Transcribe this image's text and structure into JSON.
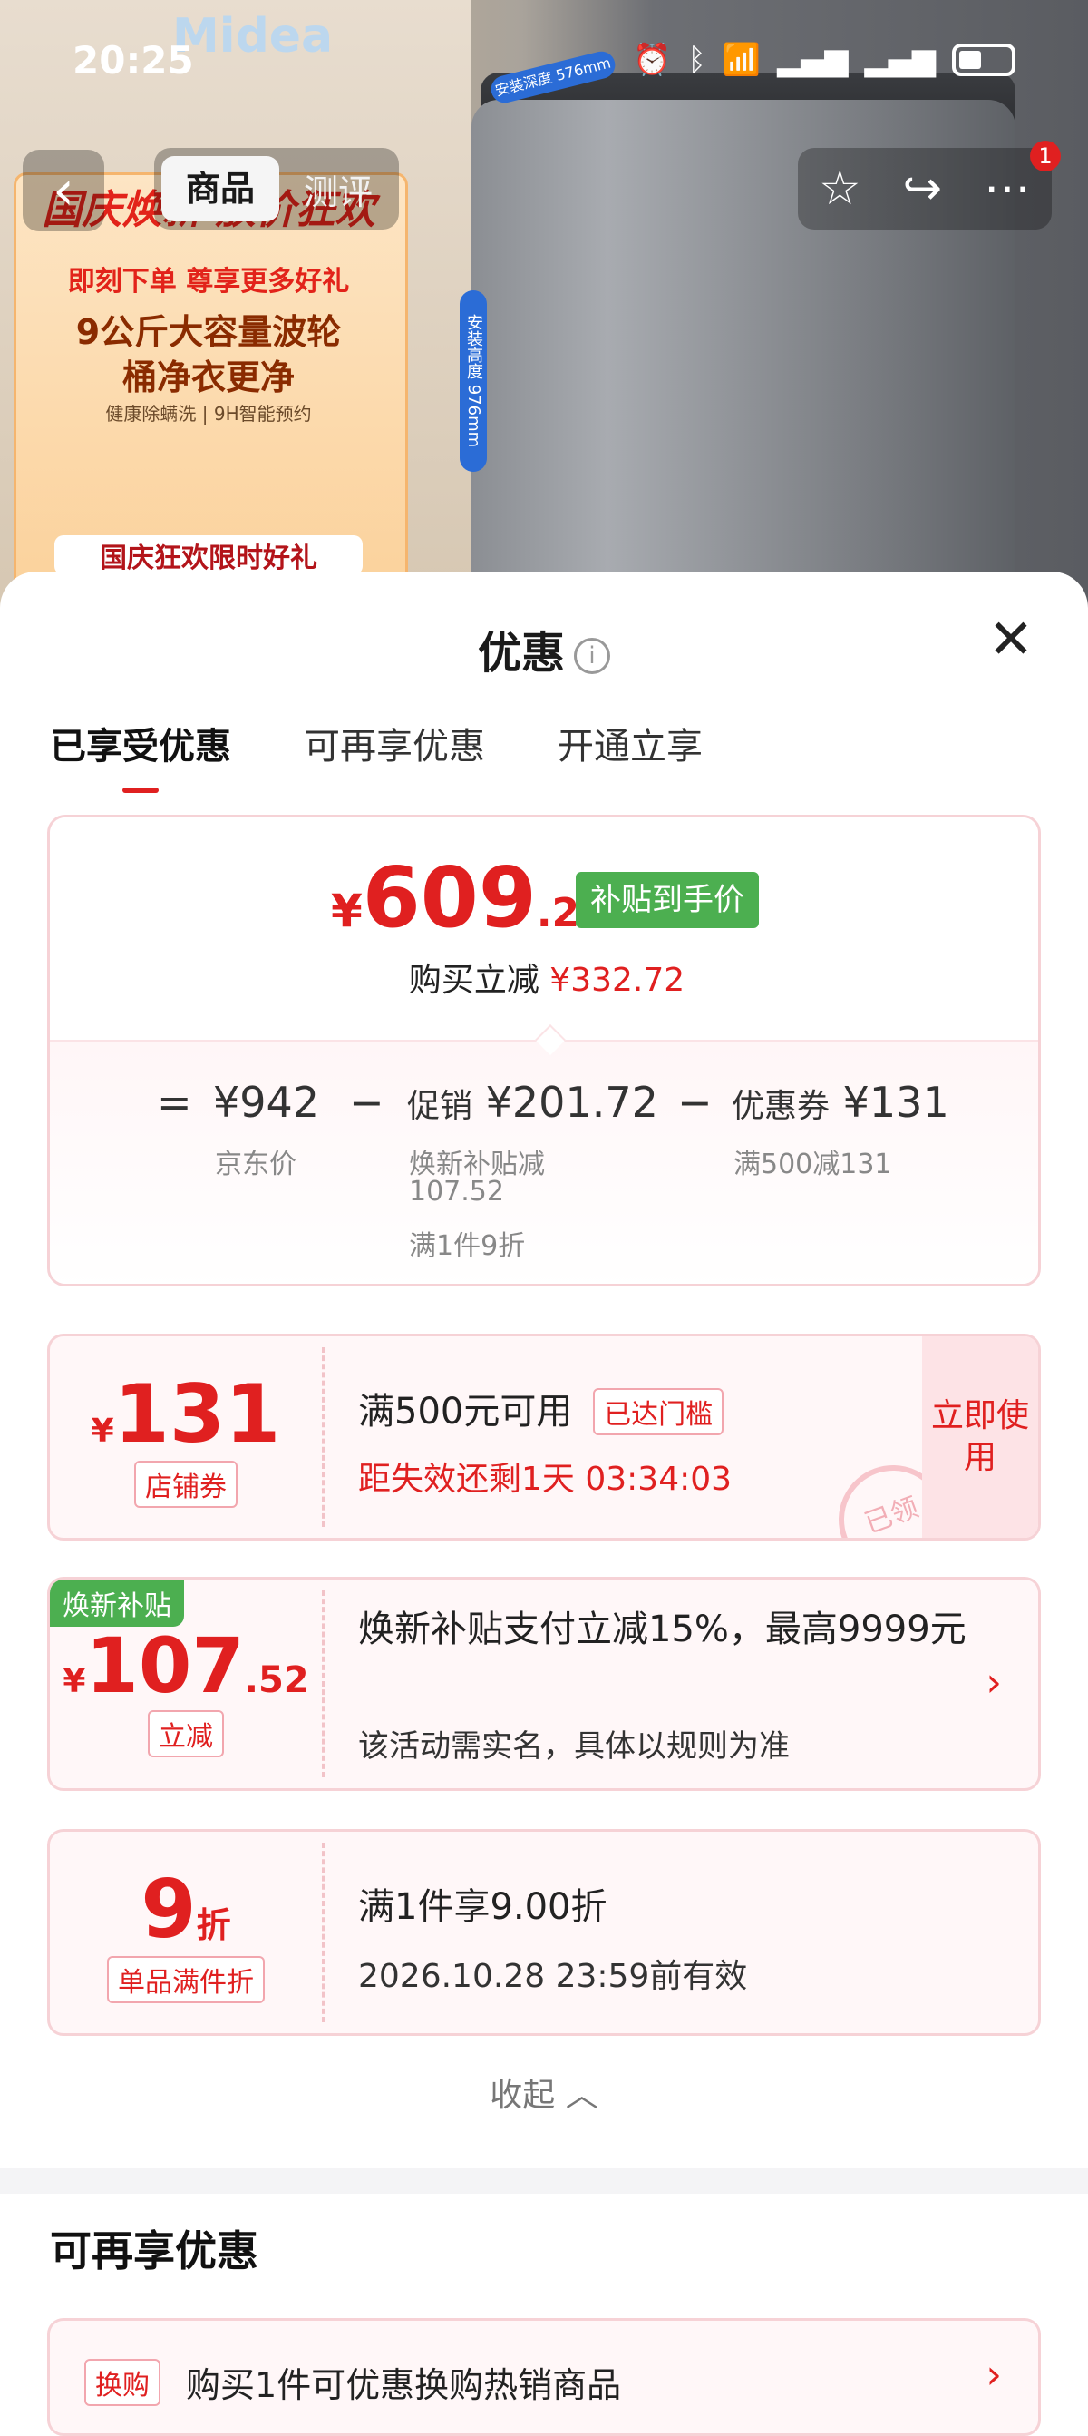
{
  "status_bar": {
    "time": "20:25"
  },
  "hero": {
    "brand": "Midea",
    "poster_headline": "国庆焕新 放价狂欢",
    "poster_sub": "即刻下单 尊享更多好礼",
    "poster_feature_1": "9公斤大容量波轮",
    "poster_feature_2": "桶净衣更净",
    "poster_feature_note": "健康除螨洗 | 9H智能预约",
    "poster_bottom": "国庆狂欢限时好礼",
    "dim_height": "安装高度 976mm",
    "dim_depth": "安装深度 576mm"
  },
  "nav": {
    "tab_product": "商品",
    "tab_review": "测评",
    "notification_count": "1"
  },
  "sheet": {
    "title": "优惠",
    "tabs": [
      "已享受优惠",
      "可再享优惠",
      "开通立享"
    ]
  },
  "summary": {
    "price_yen": "¥",
    "price_int": "609",
    "price_dec": ".28",
    "subsidy_tag": "补贴到手价",
    "reduce_label": "购买立减",
    "reduce_amount": "¥332.72",
    "eq_sign": "=",
    "jd_price": "¥942",
    "jd_price_label": "京东价",
    "minus": "−",
    "promo_label": "促销",
    "promo_amount": "¥201.72",
    "promo_detail_1": "焕新补贴减",
    "promo_detail_2": "107.52",
    "promo_detail_3": "满1件9折",
    "coupon_label": "优惠券",
    "coupon_amount": "¥131",
    "coupon_detail": "满500减131"
  },
  "coupon_store": {
    "yen": "¥",
    "amount": "131",
    "type": "店铺券",
    "condition": "满500元可用",
    "threshold_tag": "已达门槛",
    "countdown": "距失效还剩1天 03:34:03",
    "use_now": "立即使用",
    "stamp": "已领"
  },
  "coupon_subsidy": {
    "corner_tag": "焕新补贴",
    "yen": "¥",
    "amount_int": "107",
    "amount_dec": ".52",
    "type": "立减",
    "desc": "焕新补贴支付立减15%，最高9999元",
    "note": "该活动需实名，具体以规则为准"
  },
  "coupon_discount": {
    "amount": "9",
    "unit": "折",
    "type": "单品满件折",
    "desc": "满1件享9.00折",
    "validity": "2026.10.28 23:59前有效"
  },
  "collapse_label": "收起",
  "more_section": {
    "title": "可再享优惠",
    "exchange_tag": "换购",
    "exchange_text": "购买1件可优惠换购热销商品"
  }
}
